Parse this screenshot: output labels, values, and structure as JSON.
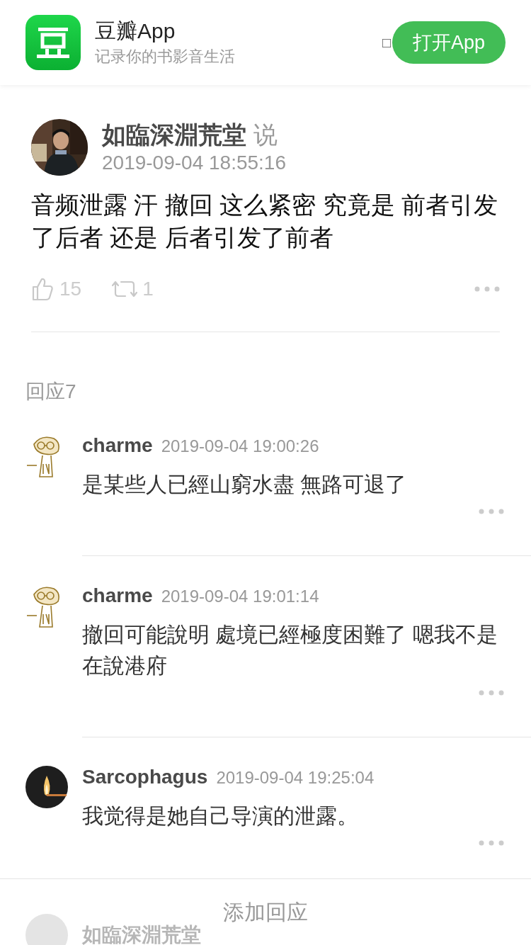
{
  "banner": {
    "app_name": "豆瓣App",
    "tagline": "记录你的书影音生活",
    "glyph": "□",
    "open_button": "打开App"
  },
  "post": {
    "author": "如臨深淵荒堂",
    "verb": "说",
    "time": "2019-09-04 18:55:16",
    "text": "音频泄露 汗 撤回 这么紧密 究竟是 前者引发了后者 还是 后者引发了前者",
    "likes": "15",
    "reshares": "1"
  },
  "replies_heading": "回应7",
  "comments": [
    {
      "author": "charme",
      "time": "2019-09-04 19:00:26",
      "text": "是某些人已經山窮水盡 無路可退了",
      "kind": "sketch"
    },
    {
      "author": "charme",
      "time": "2019-09-04 19:01:14",
      "text": "撤回可能說明 處境已經極度困難了 嗯我不是在說港府",
      "kind": "sketch"
    },
    {
      "author": "Sarcophagus",
      "time": "2019-09-04 19:25:04",
      "text": "我觉得是她自己导演的泄露。",
      "kind": "flame"
    }
  ],
  "partial_comment": {
    "author": "如臨深淵荒堂"
  },
  "bottom_bar": {
    "label": "添加回应"
  }
}
